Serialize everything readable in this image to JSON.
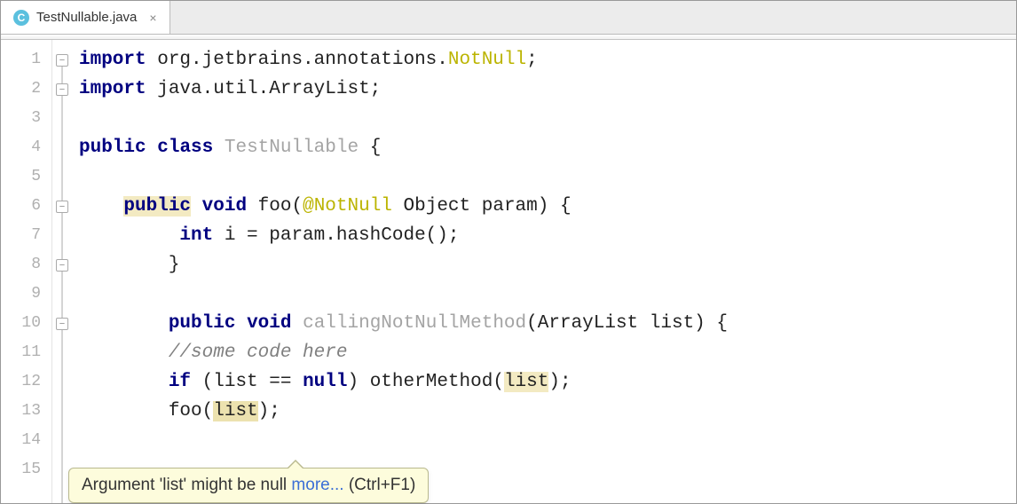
{
  "tab": {
    "icon_letter": "C",
    "filename": "TestNullable.java",
    "close": "×"
  },
  "lines": [
    "1",
    "2",
    "3",
    "4",
    "5",
    "6",
    "7",
    "8",
    "9",
    "10",
    "11",
    "12",
    "13",
    "14",
    "15"
  ],
  "code": {
    "l1": {
      "a": "import",
      "b": " org.jetbrains.annotations.",
      "c": "NotNull",
      "d": ";"
    },
    "l2": {
      "a": "import",
      "b": " java.util.ArrayList;"
    },
    "l4": {
      "a": "public",
      "b": " ",
      "c": "class",
      "d": " ",
      "e": "TestNullable",
      "f": " {"
    },
    "l6": {
      "pad": "    ",
      "a": "public",
      "b": " ",
      "c": "void",
      "d": " foo(",
      "e": "@NotNull",
      "f": " Object param) {"
    },
    "l7": {
      "pad": "         ",
      "a": "int",
      "b": " i = param.hashCode();"
    },
    "l8": {
      "pad": "        ",
      "a": "}"
    },
    "l10": {
      "pad": "        ",
      "a": "public",
      "b": " ",
      "c": "void",
      "d": " ",
      "e": "callingNotNullMethod",
      "f": "(ArrayList list) {"
    },
    "l11": {
      "pad": "        ",
      "a": "//some code here"
    },
    "l12": {
      "pad": "        ",
      "a": "if",
      "b": " (list == ",
      "c": "null",
      "d": ") otherMethod(",
      "e": "list",
      "f": ");"
    },
    "l13": {
      "pad": "        ",
      "a": "foo(",
      "b": "list",
      "c": ");"
    }
  },
  "tooltip": {
    "msg": "Argument 'list' might be null ",
    "link": "more...",
    "hint": " (Ctrl+F1)"
  }
}
